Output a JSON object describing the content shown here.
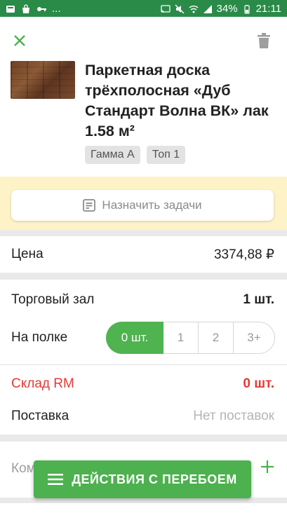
{
  "status_bar": {
    "battery": "34%",
    "time": "21:11",
    "more": "..."
  },
  "product": {
    "title": "Паркетная доска трёхполосная «Дуб Стандарт Волна ВК» лак 1.58 м²",
    "tags": [
      "Гамма А",
      "Топ 1"
    ]
  },
  "actions": {
    "assign_label": "Назначить задачи",
    "fab_label": "ДЕЙСТВИЯ С ПЕРЕБОЕМ"
  },
  "price": {
    "label": "Цена",
    "value": "3374,88 ₽"
  },
  "stock": {
    "sales_floor_label": "Торговый зал",
    "sales_floor_value": "1 шт.",
    "shelf_label": "На полке",
    "shelf_options": [
      "0 шт.",
      "1",
      "2",
      "3+"
    ],
    "shelf_selected": "0 шт.",
    "warehouse_label": "Склад RM",
    "warehouse_value": "0 шт.",
    "delivery_label": "Поставка",
    "delivery_value": "Нет поставок"
  },
  "comment": {
    "label_partial": "Ком"
  },
  "colors": {
    "accent": "#4fb34f",
    "status_bar": "#2a8b48",
    "warning": "#e53935",
    "highlight_band": "#fdf3c6"
  },
  "icons": [
    "close-icon",
    "trash-icon",
    "task-list-icon",
    "menu-icon",
    "add-icon"
  ]
}
